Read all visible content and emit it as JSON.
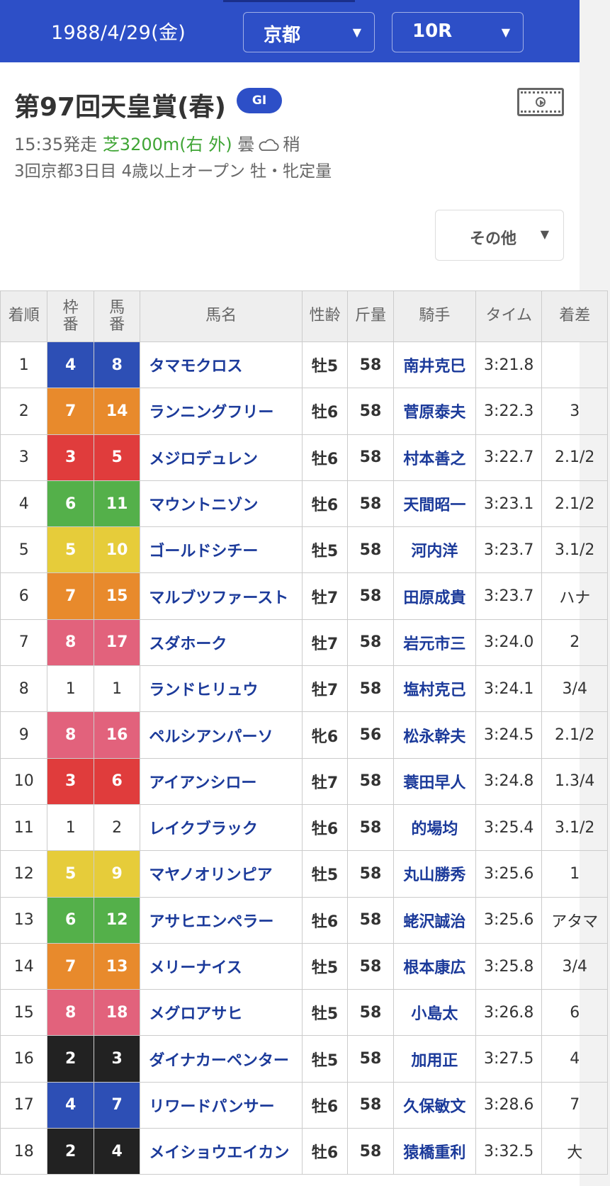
{
  "header": {
    "date": "1988/4/29(金)",
    "place": "京都",
    "race_no": "10R",
    "arrow": "▼"
  },
  "race": {
    "title": "第97回天皇賞(春)",
    "grade": "GI",
    "time": "15:35発走",
    "course": "芝3200m(右 外)",
    "weather": "曇",
    "going": "稍",
    "conditions": "3回京都3日目 4歳以上オープン 牡・牝定量"
  },
  "other_button": {
    "label": "その他",
    "arrow": "▼"
  },
  "waku_colors": {
    "1": "#ffffff",
    "2": "#222222",
    "3": "#e03c3c",
    "4": "#2d4fb5",
    "5": "#e6cc3a",
    "6": "#54b04a",
    "7": "#e88a2c",
    "8": "#e2627c"
  },
  "table": {
    "headers": {
      "rank": "着順",
      "waku": "枠番",
      "uma": "馬番",
      "horse": "馬名",
      "sex_age": "性齢",
      "weight": "斤量",
      "jockey": "騎手",
      "time": "タイム",
      "margin": "着差"
    },
    "rows": [
      {
        "rank": "1",
        "waku": "4",
        "uma": "8",
        "horse": "タマモクロス",
        "sex_age": "牡5",
        "weight": "58",
        "jockey": "南井克巳",
        "time": "3:21.8",
        "margin": ""
      },
      {
        "rank": "2",
        "waku": "7",
        "uma": "14",
        "horse": "ランニングフリー",
        "sex_age": "牡6",
        "weight": "58",
        "jockey": "菅原泰夫",
        "time": "3:22.3",
        "margin": "3"
      },
      {
        "rank": "3",
        "waku": "3",
        "uma": "5",
        "horse": "メジロデュレン",
        "sex_age": "牡6",
        "weight": "58",
        "jockey": "村本善之",
        "time": "3:22.7",
        "margin": "2.1/2"
      },
      {
        "rank": "4",
        "waku": "6",
        "uma": "11",
        "horse": "マウントニゾン",
        "sex_age": "牡6",
        "weight": "58",
        "jockey": "天間昭一",
        "time": "3:23.1",
        "margin": "2.1/2"
      },
      {
        "rank": "5",
        "waku": "5",
        "uma": "10",
        "horse": "ゴールドシチー",
        "sex_age": "牡5",
        "weight": "58",
        "jockey": "河内洋",
        "time": "3:23.7",
        "margin": "3.1/2"
      },
      {
        "rank": "6",
        "waku": "7",
        "uma": "15",
        "horse": "マルブツファースト",
        "sex_age": "牡7",
        "weight": "58",
        "jockey": "田原成貴",
        "time": "3:23.7",
        "margin": "ハナ"
      },
      {
        "rank": "7",
        "waku": "8",
        "uma": "17",
        "horse": "スダホーク",
        "sex_age": "牡7",
        "weight": "58",
        "jockey": "岩元市三",
        "time": "3:24.0",
        "margin": "2"
      },
      {
        "rank": "8",
        "waku": "1",
        "uma": "1",
        "horse": "ランドヒリュウ",
        "sex_age": "牡7",
        "weight": "58",
        "jockey": "塩村克己",
        "time": "3:24.1",
        "margin": "3/4"
      },
      {
        "rank": "9",
        "waku": "8",
        "uma": "16",
        "horse": "ペルシアンパーソ",
        "sex_age": "牝6",
        "weight": "56",
        "jockey": "松永幹夫",
        "time": "3:24.5",
        "margin": "2.1/2"
      },
      {
        "rank": "10",
        "waku": "3",
        "uma": "6",
        "horse": "アイアンシロー",
        "sex_age": "牡7",
        "weight": "58",
        "jockey": "蓑田早人",
        "time": "3:24.8",
        "margin": "1.3/4"
      },
      {
        "rank": "11",
        "waku": "1",
        "uma": "2",
        "horse": "レイクブラック",
        "sex_age": "牡6",
        "weight": "58",
        "jockey": "的場均",
        "time": "3:25.4",
        "margin": "3.1/2"
      },
      {
        "rank": "12",
        "waku": "5",
        "uma": "9",
        "horse": "マヤノオリンピア",
        "sex_age": "牡5",
        "weight": "58",
        "jockey": "丸山勝秀",
        "time": "3:25.6",
        "margin": "1"
      },
      {
        "rank": "13",
        "waku": "6",
        "uma": "12",
        "horse": "アサヒエンペラー",
        "sex_age": "牡6",
        "weight": "58",
        "jockey": "蛯沢誠治",
        "time": "3:25.6",
        "margin": "アタマ"
      },
      {
        "rank": "14",
        "waku": "7",
        "uma": "13",
        "horse": "メリーナイス",
        "sex_age": "牡5",
        "weight": "58",
        "jockey": "根本康広",
        "time": "3:25.8",
        "margin": "3/4"
      },
      {
        "rank": "15",
        "waku": "8",
        "uma": "18",
        "horse": "メグロアサヒ",
        "sex_age": "牡5",
        "weight": "58",
        "jockey": "小島太",
        "time": "3:26.8",
        "margin": "6"
      },
      {
        "rank": "16",
        "waku": "2",
        "uma": "3",
        "horse": "ダイナカーペンター",
        "sex_age": "牡5",
        "weight": "58",
        "jockey": "加用正",
        "time": "3:27.5",
        "margin": "4"
      },
      {
        "rank": "17",
        "waku": "4",
        "uma": "7",
        "horse": "リワードパンサー",
        "sex_age": "牡6",
        "weight": "58",
        "jockey": "久保敏文",
        "time": "3:28.6",
        "margin": "7"
      },
      {
        "rank": "18",
        "waku": "2",
        "uma": "4",
        "horse": "メイショウエイカン",
        "sex_age": "牡6",
        "weight": "58",
        "jockey": "猿橋重利",
        "time": "3:32.5",
        "margin": "大"
      }
    ]
  }
}
